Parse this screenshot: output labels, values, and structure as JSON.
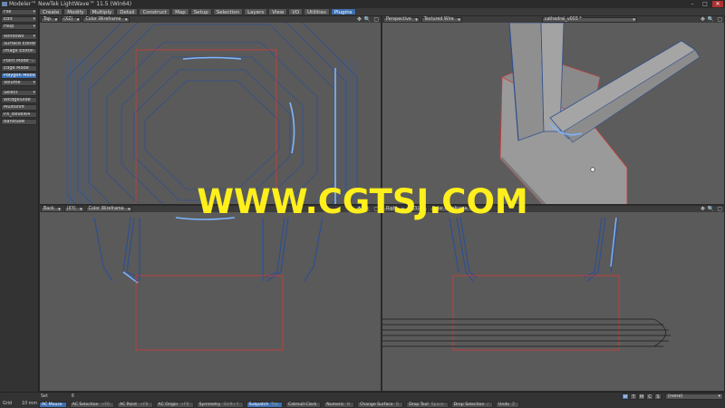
{
  "window": {
    "title": "Modeler™ NewTek LightWave™ 11.5 (Win64)",
    "controls": [
      "–",
      "□",
      "✕"
    ]
  },
  "menu_tabs": [
    {
      "label": "Create",
      "active": false
    },
    {
      "label": "Modify",
      "active": false
    },
    {
      "label": "Multiply",
      "active": false
    },
    {
      "label": "Detail",
      "active": false
    },
    {
      "label": "Construct",
      "active": false
    },
    {
      "label": "Map",
      "active": false
    },
    {
      "label": "Setup",
      "active": false
    },
    {
      "label": "Selection",
      "active": false
    },
    {
      "label": "Layers",
      "active": false
    },
    {
      "label": "View",
      "active": false
    },
    {
      "label": "I/O",
      "active": false
    },
    {
      "label": "Utilities",
      "active": false
    },
    {
      "label": "Plugins",
      "active": true
    }
  ],
  "sidebar": {
    "menus": [
      {
        "label": "File"
      },
      {
        "label": "Edit"
      },
      {
        "label": "Help"
      }
    ],
    "windows": {
      "label": "Windows"
    },
    "window_items": [
      {
        "label": "Surface Editor",
        "key": "F5"
      },
      {
        "label": "Image Editor",
        "key": "F6"
      }
    ],
    "modes": [
      {
        "label": "Point Mode",
        "key": "^G",
        "active": false
      },
      {
        "label": "Edge Mode",
        "key": "",
        "active": false
      },
      {
        "label": "Polygon Mode",
        "key": "^H",
        "active": true
      },
      {
        "label": "Volume",
        "key": "",
        "active": false
      }
    ],
    "select": {
      "label": "Select"
    },
    "plugins": [
      {
        "label": "WEdgeSlide"
      },
      {
        "label": "Multishift"
      },
      {
        "label": "PX_Bevel64"
      },
      {
        "label": "BandSaw"
      }
    ]
  },
  "viewports": {
    "top_left": {
      "view": "Top",
      "axis": "(XZ)",
      "shading": "Color Wireframe"
    },
    "top_right": {
      "view": "Perspective",
      "shading": "Textured Wire",
      "object": "cathedral_v003 *"
    },
    "bottom_left": {
      "view": "Back",
      "axis": "(XY)",
      "shading": "Color Wireframe"
    },
    "bottom_right": {
      "view": "Right",
      "axis": "(ZY)",
      "shading": "Color Wireframe"
    },
    "tool_icons": [
      "✥",
      "🔍",
      "⤢",
      "▢"
    ]
  },
  "bottom_panel": {
    "grid_label": "Grid",
    "grid_value": "10 mm",
    "set_label": "Set",
    "set_value": "6",
    "toolbar": [
      {
        "label": "AC Mouse",
        "key": "",
        "active": true
      },
      {
        "label": "AC Selection",
        "key": "+F6",
        "active": false
      },
      {
        "label": "AC Point",
        "key": "+F8",
        "active": false
      },
      {
        "label": "AC Origin",
        "key": "+F9",
        "active": false
      },
      {
        "label": "Symmetry",
        "key": "Shift+Y",
        "active": false
      },
      {
        "label": "Subpatch",
        "key": "Tab",
        "active": true
      },
      {
        "label": "Catmull-Clark",
        "key": "",
        "active": false
      },
      {
        "label": "Numeric",
        "key": "N",
        "active": false
      },
      {
        "label": "Change Surface",
        "key": "Q",
        "active": false
      },
      {
        "label": "Drop Tool",
        "key": "Space",
        "active": false
      },
      {
        "label": "Drop Selection",
        "key": "/",
        "active": false
      },
      {
        "label": "Undo",
        "key": "Z",
        "active": false
      }
    ],
    "modes": [
      {
        "label": "W",
        "active": true
      },
      {
        "label": "T",
        "active": false
      },
      {
        "label": "M",
        "active": false
      },
      {
        "label": "C",
        "active": false
      },
      {
        "label": "S",
        "active": false
      }
    ],
    "vertex_map": "(none)"
  },
  "watermark": "WWW.CGTSJ.COM"
}
